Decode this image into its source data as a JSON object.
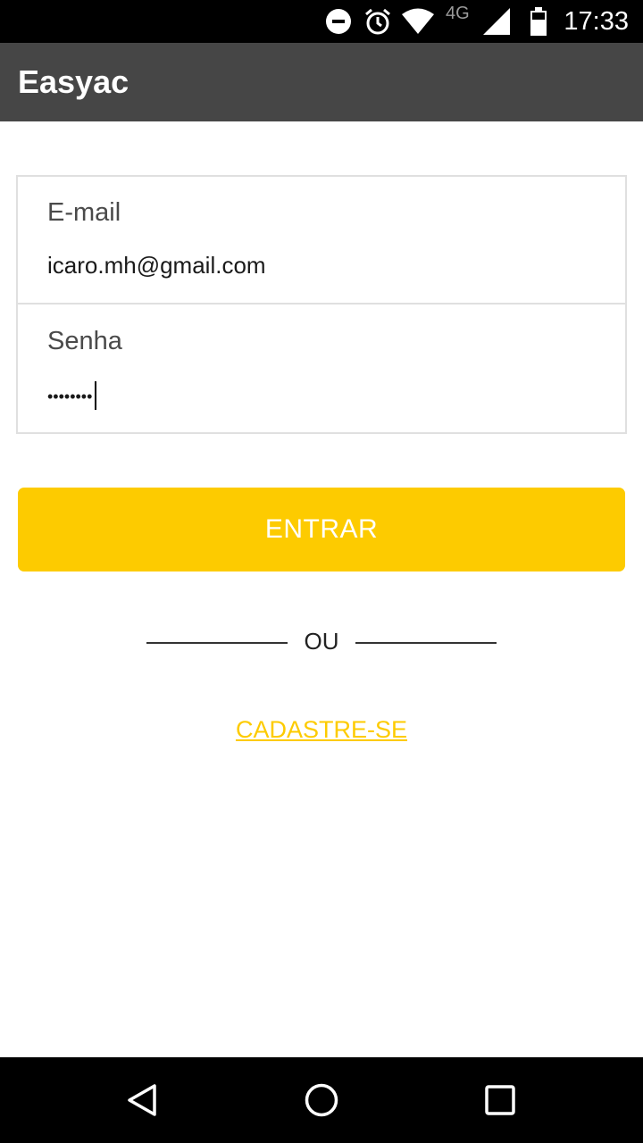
{
  "status_bar": {
    "time": "17:33",
    "network": "4G",
    "icons": [
      "do-not-disturb-icon",
      "alarm-icon",
      "wifi-icon",
      "cell-signal-icon",
      "battery-icon"
    ]
  },
  "app_bar": {
    "title": "Easyac"
  },
  "login_form": {
    "email_label": "E-mail",
    "email_value": "icaro.mh@gmail.com",
    "password_label": "Senha",
    "password_value": "••••••••"
  },
  "actions": {
    "login_label": "ENTRAR",
    "divider_label": "OU",
    "signup_label": "CADASTRE-SE"
  },
  "colors": {
    "accent": "#fdcb00",
    "app_bar": "#464646",
    "status_bar": "#000000"
  },
  "nav_bar": {
    "icons": [
      "back-icon",
      "home-icon",
      "recents-icon"
    ]
  }
}
